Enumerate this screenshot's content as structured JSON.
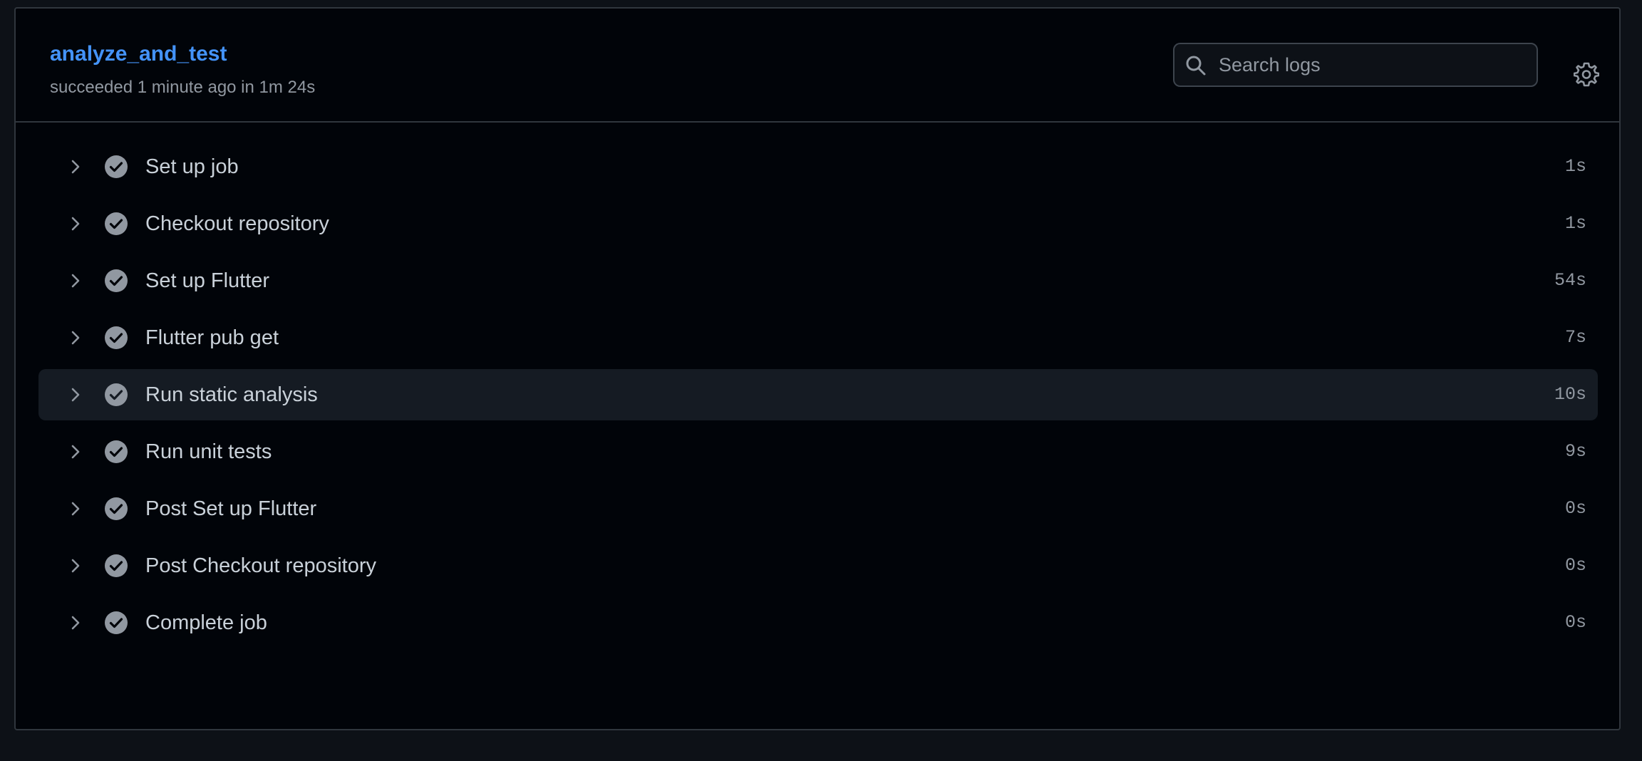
{
  "job": {
    "title": "analyze_and_test",
    "subtitle": "succeeded 1 minute ago in 1m 24s"
  },
  "search": {
    "placeholder": "Search logs",
    "value": ""
  },
  "icons": {
    "search": "search-icon",
    "settings": "gear-icon",
    "expand": "chevron-right-icon",
    "status": "check-circle-icon"
  },
  "colors": {
    "title_link": "#4493f8",
    "success_icon": "#9198a1",
    "highlight_row": "#151b23"
  },
  "steps": [
    {
      "label": "Set up job",
      "duration": "1s"
    },
    {
      "label": "Checkout repository",
      "duration": "1s"
    },
    {
      "label": "Set up Flutter",
      "duration": "54s"
    },
    {
      "label": "Flutter pub get",
      "duration": "7s"
    },
    {
      "label": "Run static analysis",
      "duration": "10s"
    },
    {
      "label": "Run unit tests",
      "duration": "9s"
    },
    {
      "label": "Post Set up Flutter",
      "duration": "0s"
    },
    {
      "label": "Post Checkout repository",
      "duration": "0s"
    },
    {
      "label": "Complete job",
      "duration": "0s"
    }
  ]
}
